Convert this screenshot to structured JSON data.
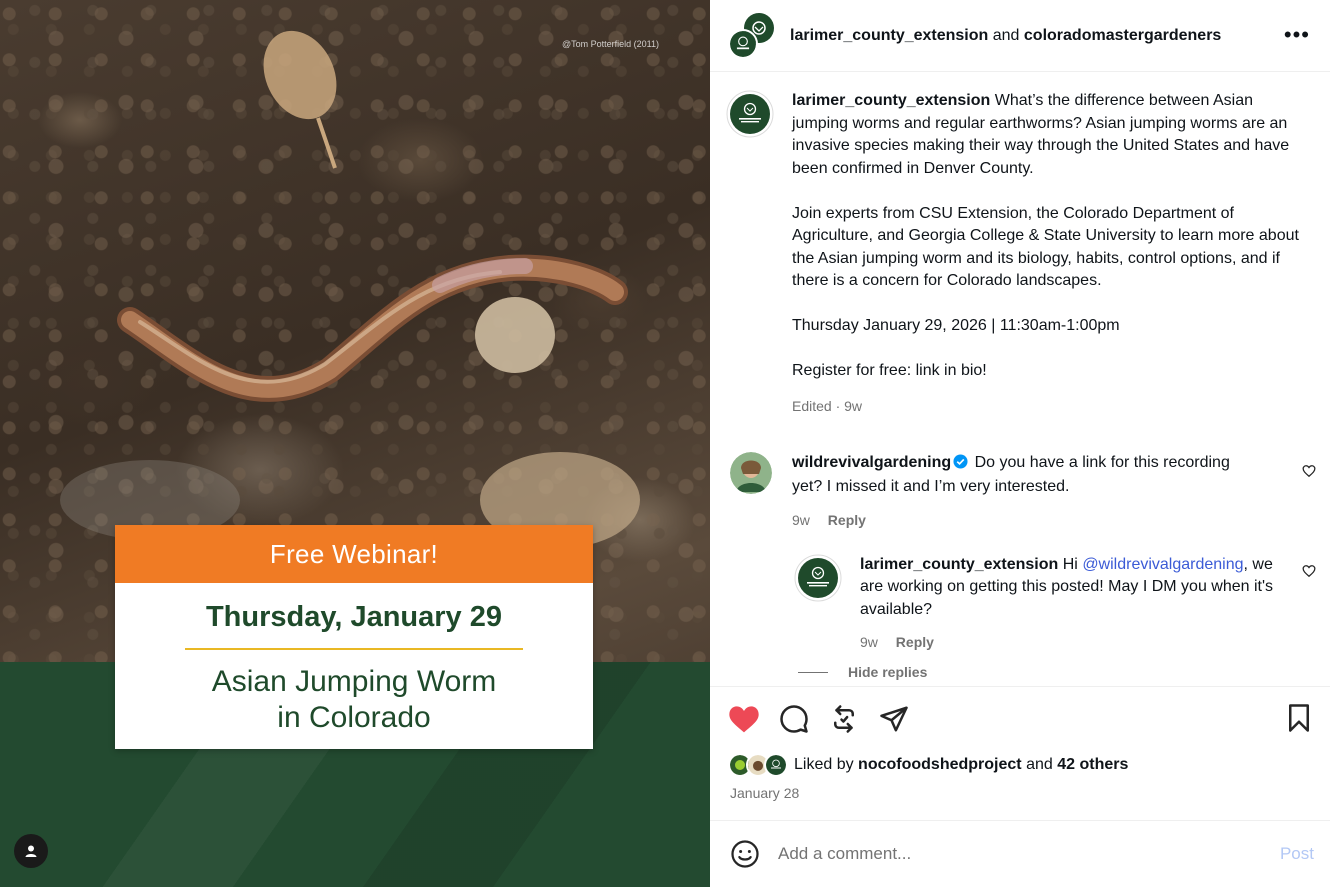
{
  "media": {
    "watermark": "@Tom Potterfield (2011)",
    "card": {
      "header": "Free Webinar!",
      "date": "Thursday, January 29",
      "title_line1": "Asian Jumping Worm",
      "title_line2": "in Colorado"
    }
  },
  "header": {
    "user1": "larimer_county_extension",
    "joiner": "and",
    "user2": "coloradomastergardeners",
    "more": "•••"
  },
  "caption": {
    "username": "larimer_county_extension",
    "para1": "What’s the difference between Asian jumping worms and regular earthworms? Asian jumping worms are an invasive species making their way through the United States and have been confirmed in Denver County.",
    "para2": "Join experts from CSU Extension, the Colorado Department of Agriculture, and Georgia College & State University to learn more about the Asian jumping worm and its biology, habits, control options, and if there is a concern for Colorado landscapes.",
    "para3": "Thursday January 29, 2026 | 11:30am-1:00pm",
    "para4": "Register for free: link in bio!",
    "meta": "Edited · 9w"
  },
  "comments": [
    {
      "username": "wildrevivalgardening",
      "text": "Do you have a link for this recording yet? I missed it and I’m very interested.",
      "time": "9w",
      "reply_label": "Reply"
    }
  ],
  "reply": {
    "username": "larimer_county_extension",
    "prefix": "Hi",
    "mention": "@wildrevivalgardening",
    "text": ", we are working on getting this posted! May I DM you when it's available?",
    "time": "9w",
    "reply_label": "Reply"
  },
  "hide_replies": "Hide replies",
  "likes": {
    "prefix": "Liked by",
    "user": "nocofoodshedproject",
    "joiner": "and",
    "others": "42 others"
  },
  "post_date": "January 28",
  "comment_box": {
    "placeholder": "Add a comment...",
    "post_label": "Post"
  },
  "colors": {
    "heart": "#ed4956",
    "orange": "#f07b24",
    "csu_green": "#1f4a2b",
    "mention": "#3b5bd6",
    "post_disabled": "#b3c8f5"
  }
}
